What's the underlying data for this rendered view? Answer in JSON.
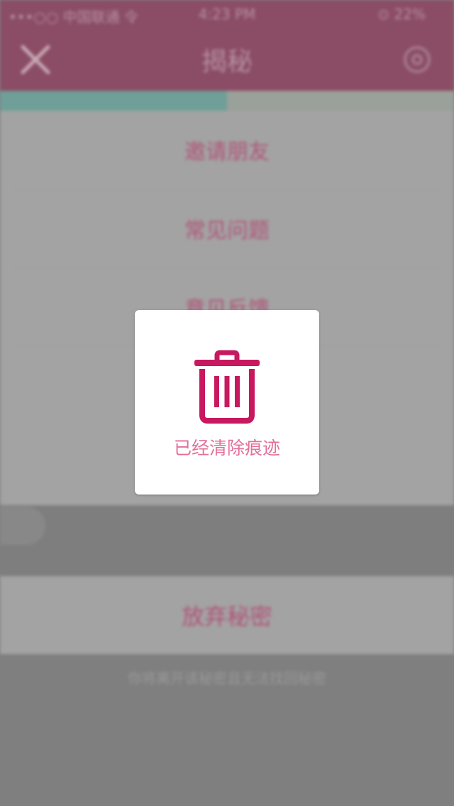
{
  "status_bar": {
    "carrier": "•••○○ 中国联通 令",
    "time": "4:23 PM",
    "battery": "⊙ 22%"
  },
  "nav": {
    "title": "揭秘",
    "close_icon": "close-icon",
    "right_icon": "gear-icon"
  },
  "progress": {
    "value": 0.5,
    "fill_color": "#6f9f98",
    "track_color": "#9aa09a"
  },
  "menu": {
    "items": [
      {
        "label": "邀请朋友"
      },
      {
        "label": "常见问题"
      },
      {
        "label": "意见反馈"
      }
    ]
  },
  "bottom": {
    "abandon_label": "放弃秘密",
    "footer_note": "你将离开该秘密且无法找回秘密"
  },
  "toast": {
    "icon": "trash-icon",
    "message": "已经清除痕迹",
    "accent_color": "#c8185f"
  }
}
